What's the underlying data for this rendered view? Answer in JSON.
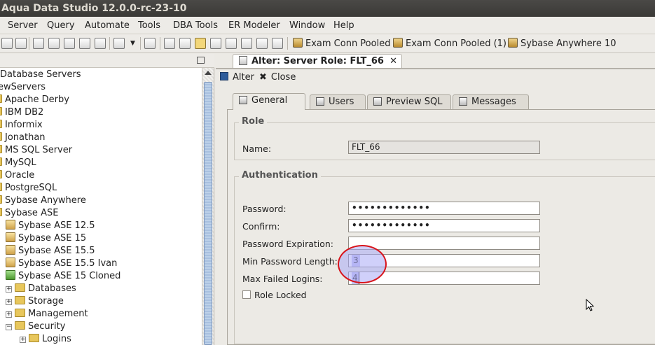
{
  "window": {
    "title": "Aqua Data Studio 12.0.0-rc-23-10"
  },
  "menu": [
    "Server",
    "Query",
    "Automate",
    "Tools",
    "DBA Tools",
    "ER Modeler",
    "Window",
    "Help"
  ],
  "toolbar": {
    "connections": [
      "Exam Conn Pooled",
      "Exam Conn Pooled (1)",
      "Sybase Anywhere 10"
    ]
  },
  "tree": {
    "items": [
      {
        "label": "Database Servers"
      },
      {
        "label": "ewServers"
      },
      {
        "label": "Apache Derby"
      },
      {
        "label": "IBM DB2"
      },
      {
        "label": "Informix"
      },
      {
        "label": "Jonathan"
      },
      {
        "label": "MS SQL Server"
      },
      {
        "label": "MySQL"
      },
      {
        "label": "Oracle"
      },
      {
        "label": "PostgreSQL"
      },
      {
        "label": "Sybase Anywhere"
      },
      {
        "label": "Sybase ASE"
      },
      {
        "label": "Sybase ASE 12.5"
      },
      {
        "label": "Sybase ASE 15"
      },
      {
        "label": "Sybase ASE 15.5"
      },
      {
        "label": "Sybase ASE 15.5 Ivan"
      },
      {
        "label": "Sybase ASE 15 Cloned"
      },
      {
        "label": "Databases"
      },
      {
        "label": "Storage"
      },
      {
        "label": "Management"
      },
      {
        "label": "Security"
      },
      {
        "label": "Logins"
      }
    ]
  },
  "editor": {
    "tab_label": "Alter: Server Role: FLT_66",
    "tab_close": "✕",
    "actions": {
      "alter": "Alter",
      "close": "Close"
    },
    "subtabs": [
      "General",
      "Users",
      "Preview SQL",
      "Messages"
    ],
    "role_section": {
      "legend": "Role",
      "name_label": "Name:",
      "name_value": "FLT_66"
    },
    "auth_section": {
      "legend": "Authentication",
      "password_label": "Password:",
      "password_value": "•••••••••••••",
      "confirm_label": "Confirm:",
      "confirm_value": "•••••••••••••",
      "expiration_label": "Password Expiration:",
      "expiration_value": "",
      "min_len_label": "Min Password Length:",
      "min_len_value": "3",
      "max_failed_label": "Max Failed Logins:",
      "max_failed_value": "4",
      "role_locked_label": "Role Locked",
      "role_locked_checked": false
    }
  },
  "colors": {
    "highlight_circle": "#d8141b",
    "field_highlight": "#c3c3f4"
  }
}
